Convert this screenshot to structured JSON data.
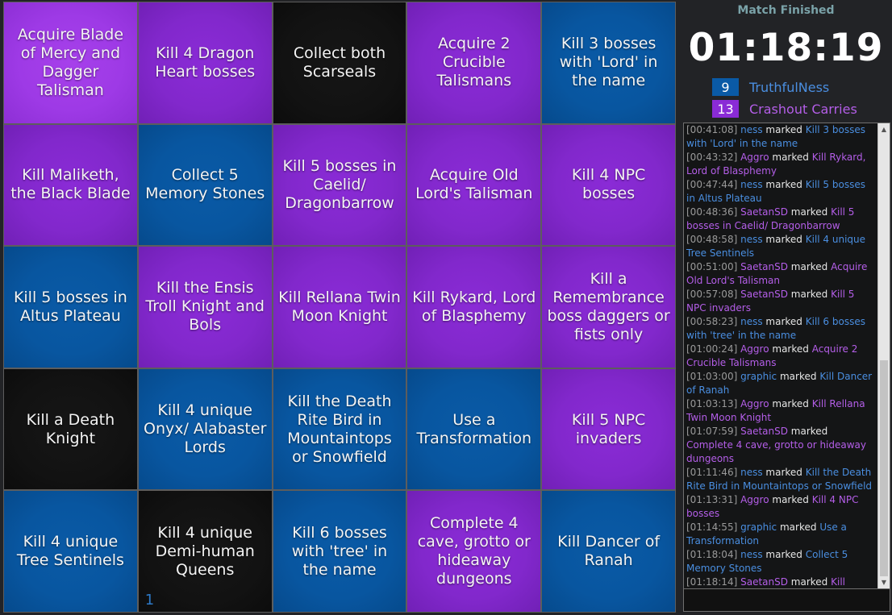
{
  "colors": {
    "blue_team": "#0a5aa6",
    "purple_team": "#8a2bd6",
    "blank": "#121212",
    "blue_text": "#4a8ee0",
    "purple_text": "#b45ee8"
  },
  "board": {
    "cells": [
      {
        "text": "Acquire Blade of Mercy and Dagger Talisman",
        "color": "purple",
        "highlight": true
      },
      {
        "text": "Kill 4 Dragon Heart bosses",
        "color": "purple"
      },
      {
        "text": "Collect both Scarseals",
        "color": "black"
      },
      {
        "text": "Acquire 2 Crucible Talismans",
        "color": "purple"
      },
      {
        "text": "Kill 3 bosses with 'Lord' in the name",
        "color": "blue"
      },
      {
        "text": "Kill Maliketh, the Black Blade",
        "color": "purple"
      },
      {
        "text": "Collect 5 Memory Stones",
        "color": "blue"
      },
      {
        "text": "Kill 5 bosses in Caelid/ Dragonbarrow",
        "color": "purple"
      },
      {
        "text": "Acquire Old Lord's Talisman",
        "color": "purple"
      },
      {
        "text": "Kill 4 NPC bosses",
        "color": "purple"
      },
      {
        "text": "Kill 5 bosses in Altus Plateau",
        "color": "blue"
      },
      {
        "text": "Kill the Ensis Troll Knight and Bols",
        "color": "purple"
      },
      {
        "text": "Kill Rellana Twin Moon Knight",
        "color": "purple"
      },
      {
        "text": "Kill Rykard, Lord of Blasphemy",
        "color": "purple"
      },
      {
        "text": "Kill a Remembrance boss daggers or fists only",
        "color": "purple"
      },
      {
        "text": "Kill a Death Knight",
        "color": "black"
      },
      {
        "text": "Kill 4 unique Onyx/ Alabaster Lords",
        "color": "blue"
      },
      {
        "text": "Kill the Death Rite Bird in Mountaintops or Snowfield",
        "color": "blue"
      },
      {
        "text": "Use a Transformation",
        "color": "blue"
      },
      {
        "text": "Kill 5 NPC invaders",
        "color": "purple"
      },
      {
        "text": "Kill 4 unique Tree Sentinels",
        "color": "blue"
      },
      {
        "text": "Kill 4 unique Demi-human Queens",
        "color": "black",
        "counter": "1"
      },
      {
        "text": "Kill 6 bosses with 'tree' in the name",
        "color": "blue"
      },
      {
        "text": "Complete 4 cave, grotto or hideaway dungeons",
        "color": "purple"
      },
      {
        "text": "Kill Dancer of Ranah",
        "color": "blue"
      }
    ]
  },
  "sidebar": {
    "status": "Match Finished",
    "timer": "01:18:19",
    "teams": [
      {
        "count": "9",
        "name": "TruthfulNess",
        "color": "blue"
      },
      {
        "count": "13",
        "name": "Crashout Carries",
        "color": "purple"
      }
    ]
  },
  "log": {
    "verb": "marked",
    "entries": [
      {
        "time": "[00:41:08]",
        "player": "ness",
        "team": "blue",
        "goal": "Kill 3 bosses with 'Lord' in the name"
      },
      {
        "time": "[00:43:32]",
        "player": "Aggro",
        "team": "purple",
        "goal": "Kill Rykard, Lord of Blasphemy"
      },
      {
        "time": "[00:47:44]",
        "player": "ness",
        "team": "blue",
        "goal": "Kill 5 bosses in Altus Plateau"
      },
      {
        "time": "[00:48:36]",
        "player": "SaetanSD",
        "team": "purple",
        "goal": "Kill 5 bosses in Caelid/ Dragonbarrow"
      },
      {
        "time": "[00:48:58]",
        "player": "ness",
        "team": "blue",
        "goal": "Kill 4 unique Tree Sentinels"
      },
      {
        "time": "[00:51:00]",
        "player": "SaetanSD",
        "team": "purple",
        "goal": "Acquire Old Lord's Talisman"
      },
      {
        "time": "[00:57:08]",
        "player": "SaetanSD",
        "team": "purple",
        "goal": "Kill 5 NPC invaders"
      },
      {
        "time": "[00:58:23]",
        "player": "ness",
        "team": "blue",
        "goal": "Kill 6 bosses with 'tree' in the name"
      },
      {
        "time": "[01:00:24]",
        "player": "Aggro",
        "team": "purple",
        "goal": "Acquire 2 Crucible Talismans"
      },
      {
        "time": "[01:03:00]",
        "player": "graphic",
        "team": "blue",
        "goal": "Kill Dancer of Ranah"
      },
      {
        "time": "[01:03:13]",
        "player": "Aggro",
        "team": "purple",
        "goal": "Kill Rellana Twin Moon Knight"
      },
      {
        "time": "[01:07:59]",
        "player": "SaetanSD",
        "team": "purple",
        "goal": "Complete 4 cave, grotto or hideaway dungeons"
      },
      {
        "time": "[01:11:46]",
        "player": "ness",
        "team": "blue",
        "goal": "Kill the Death Rite Bird in Mountaintops or Snowfield"
      },
      {
        "time": "[01:13:31]",
        "player": "Aggro",
        "team": "purple",
        "goal": "Kill 4 NPC bosses"
      },
      {
        "time": "[01:14:55]",
        "player": "graphic",
        "team": "blue",
        "goal": "Use a Transformation"
      },
      {
        "time": "[01:18:04]",
        "player": "ness",
        "team": "blue",
        "goal": "Collect 5 Memory Stones"
      },
      {
        "time": "[01:18:14]",
        "player": "SaetanSD",
        "team": "purple",
        "goal": "Kill Maliketh, the Black Blade"
      }
    ]
  },
  "icons": {
    "scroll_up": "triangle-up-icon",
    "scroll_down": "triangle-down-icon"
  }
}
